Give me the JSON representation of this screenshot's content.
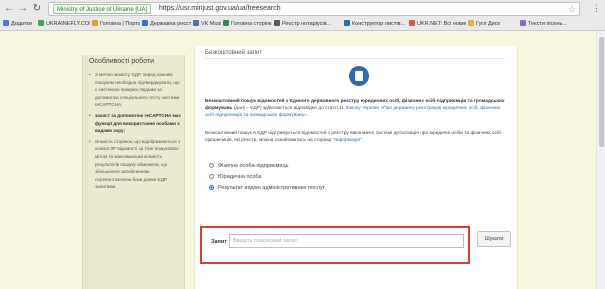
{
  "browser": {
    "secure_label": "Ministry of Justice of Ukraine [UA]",
    "url": "https://usr.minjust.gov.ua/ua/freesearch",
    "bookmarks": [
      {
        "label": "Додатки",
        "color": "#4a7bd3"
      },
      {
        "label": "UKRAINEFLY.COM.UA",
        "color": "#4aa05a"
      },
      {
        "label": "Головна | Портал...",
        "color": "#e0a030"
      },
      {
        "label": "Державна реєстра...",
        "color": "#3b73c2"
      },
      {
        "label": "VK Music",
        "color": "#4a76a8"
      },
      {
        "label": "Головна сторінка...",
        "color": "#2e8b57"
      },
      {
        "label": "Реєстр нотаріусів...",
        "color": "#5a5a5a"
      },
      {
        "label": "Конструктор листів...",
        "color": "#2a6db5"
      },
      {
        "label": "UKR.NET: Всі новини...",
        "color": "#d35a3a"
      },
      {
        "label": "Гугл Диск",
        "color": "#e2b33c"
      },
      {
        "label": "Тексти пісень...",
        "color": "#8a6bc2"
      }
    ]
  },
  "sidebar": {
    "title": "Особливості роботи",
    "items": [
      {
        "text": "З метою захисту ЄДР, перед кожним пошуком необхідно підтверджувати, що є системою прикрих людьми за допомогою спеціального тесту системи reCAPTCHA;",
        "bold": false
      },
      {
        "text": "захист за допомогою reCAPTCHA має функції для використання особами з вадами зору;",
        "bold": true
      },
      {
        "text": "кількість сторінок, що відображаються з кожної ЗР відомості за тією пошуковою мітою та максимальна кількість результатів пошуку обмежена, що збільшення запобіганням перевантаженню бази даних ЄДР запитами.",
        "bold": false
      }
    ]
  },
  "main": {
    "title": "Безкоштовний запит",
    "intro_bold": "Безкоштовний пошук відомостей з Єдиного державного реєстру юридичних осіб, фізичних осіб-підприємців та громадських формувань",
    "intro_rest": " (далі – ЄДР) здійснюється відповідно до статті 11 ",
    "intro_link": "Закону України «Про державну реєстрацію юридичних осіб, фізичних осіб-підприємців та громадських формувань»",
    "intro_end": ".",
    "info_text": "Безкоштовний пошук в ЄДР підтримується відомостей з реєстру виконавчої системі деталізація про юридичні осіби та фізичних осіб-підприємців, які реєстр, можна ознайомитись на сторінці ",
    "info_link": "\"Інформація\"",
    "info_end": ".",
    "options": [
      {
        "label": "Фізична особа-підприємець",
        "selected": false
      },
      {
        "label": "Юридична особа",
        "selected": false
      },
      {
        "label": "Результат видачі адміністративних послуг",
        "selected": true
      }
    ],
    "query_label": "Запит",
    "query_placeholder": "Введіть пошуковий запит",
    "query_value": "",
    "search_button": "Шукати"
  }
}
